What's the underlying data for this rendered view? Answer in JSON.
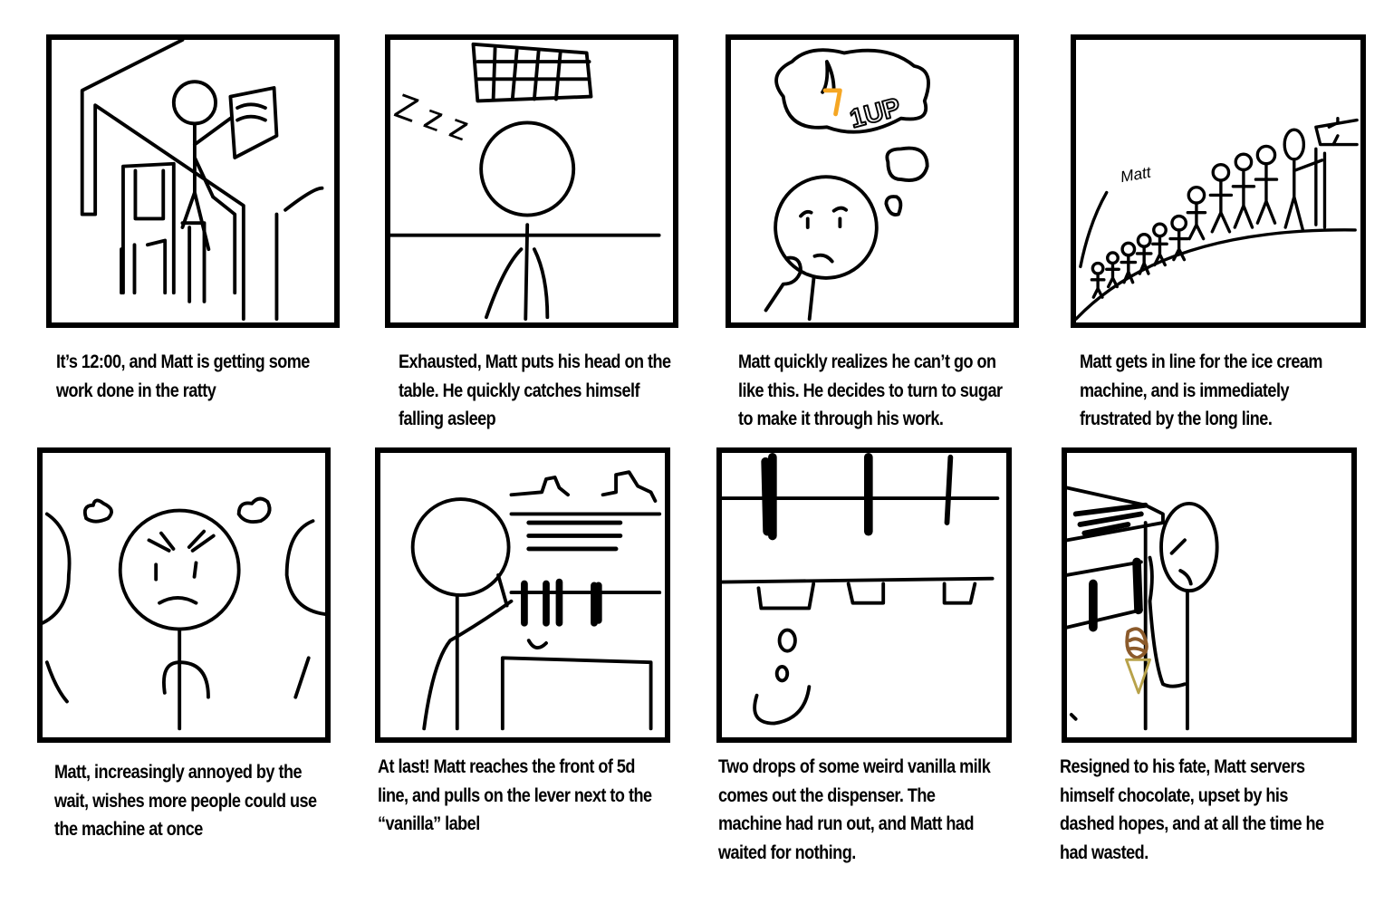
{
  "captions": [
    "It’s 12:00, and Matt is getting some work done in the ratty",
    "Exhausted, Matt puts his head on the table. He quickly catches himself falling asleep",
    "Matt quickly realizes he can’t go on like this. He decides to turn to sugar to make it through his work.",
    "Matt gets in line for the ice cream machine, and is immediately frustrated by the long line.",
    "Matt, increasingly annoyed by the wait, wishes more people could use the machine at once",
    "At last! Matt reaches the front of 5d line, and pulls on the lever next to the “vanilla” label",
    "Two drops of some weird vanilla milk comes out the dispenser. The machine had run out, and Matt had waited for nothing.",
    "Resigned to his fate, Matt servers himself chocolate, upset by his dashed hopes, and at all the time he had wasted."
  ],
  "panel_texts": {
    "zzz": "Z z z",
    "oneup": "1UP",
    "matt_label": "Matt"
  },
  "colors": {
    "ink": "#000000",
    "orange": "#F5A623",
    "chocolate": "#8B5A2B",
    "cone": "#B8A24A"
  }
}
